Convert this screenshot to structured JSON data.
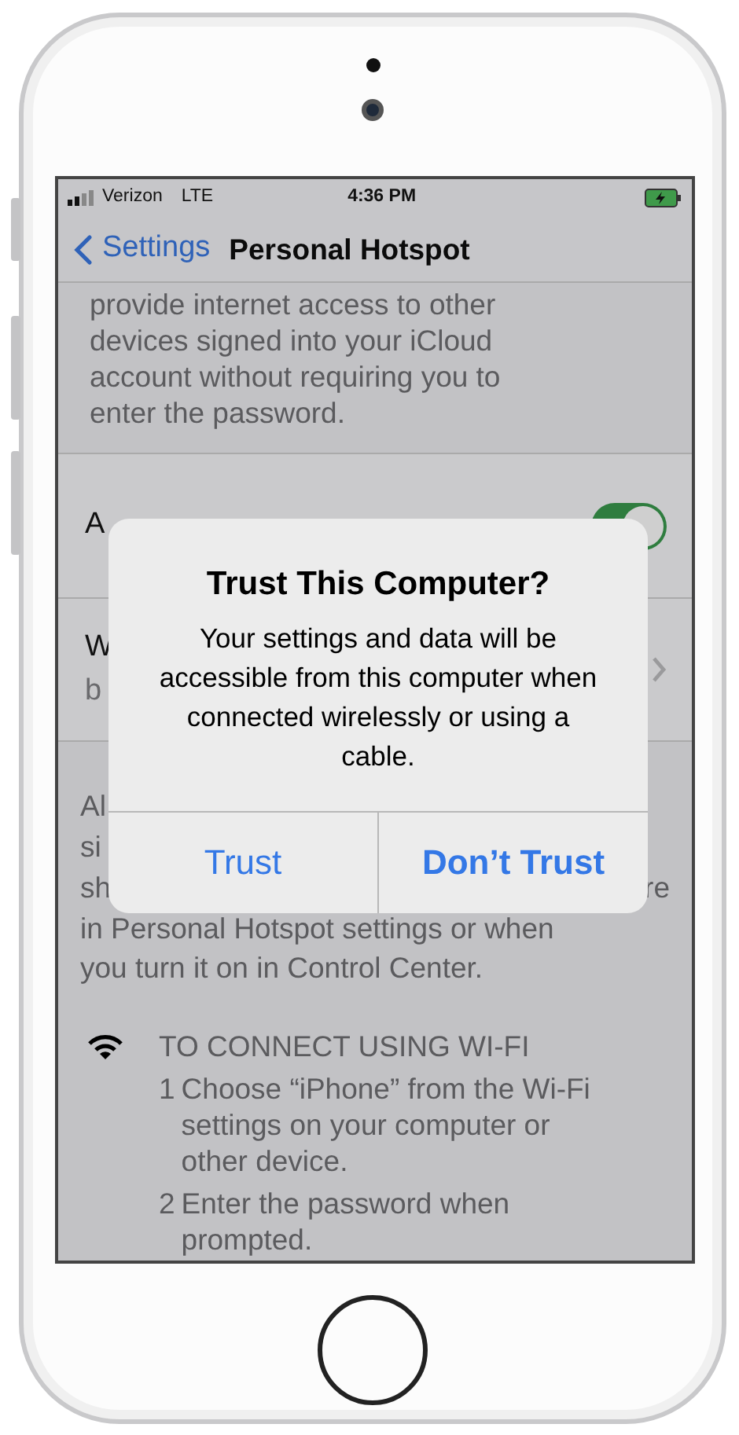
{
  "status_bar": {
    "carrier": "Verizon",
    "network": "LTE",
    "time": "4:36 PM"
  },
  "nav": {
    "back": "Settings",
    "title": "Personal Hotspot"
  },
  "intro_lines": [
    "provide internet access to other",
    "devices signed into your iCloud",
    "account without requiring you to",
    "enter the password."
  ],
  "rows": [
    {
      "kind": "toggle",
      "label": "A",
      "on": true
    },
    {
      "kind": "link",
      "label": "W",
      "detail": "b"
    }
  ],
  "note": {
    "line_starts": [
      "Al",
      "si",
      "sh"
    ],
    "line_end": "re",
    "lines_after": [
      "in Personal Hotspot settings or when",
      "you turn it on in Control Center."
    ]
  },
  "wifi": {
    "heading": "TO CONNECT USING WI-FI",
    "steps": [
      {
        "number": "1",
        "text": "Choose “iPhone” from the Wi-Fi settings on your computer or other device."
      },
      {
        "number": "2",
        "text": "Enter the password when prompted."
      }
    ]
  },
  "alert": {
    "title": "Trust This Computer?",
    "message": "Your settings and data will be accessible from this computer when connected wirelessly or using a cable.",
    "buttons": [
      {
        "label": "Trust",
        "primary": false
      },
      {
        "label": "Don’t Trust",
        "primary": true
      }
    ]
  }
}
